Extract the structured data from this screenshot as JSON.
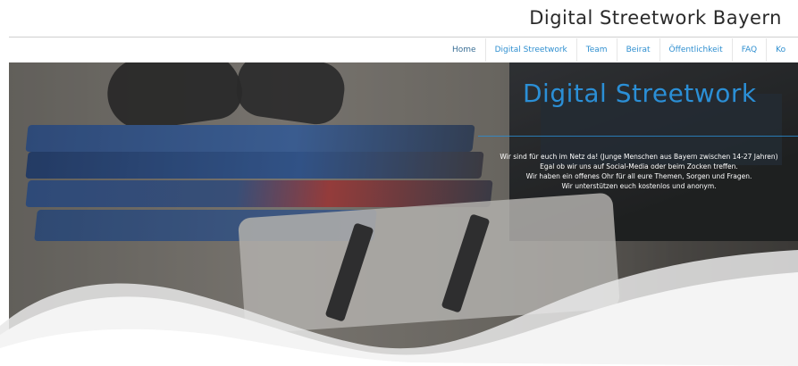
{
  "header": {
    "site_title": "Digital Streetwork Bayern"
  },
  "nav": {
    "items": [
      {
        "label": "Home",
        "active": true
      },
      {
        "label": "Digital Streetwork",
        "active": false
      },
      {
        "label": "Team",
        "active": false
      },
      {
        "label": "Beirat",
        "active": false
      },
      {
        "label": "Öffentlichkeit",
        "active": false
      },
      {
        "label": "FAQ",
        "active": false
      },
      {
        "label": "Ko",
        "active": false
      }
    ]
  },
  "hero": {
    "title": "Digital Streetwork",
    "lines": [
      "Wir sind für euch im Netz da! (Junge Menschen aus Bayern zwischen 14-27 Jahren)",
      "Egal ob wir uns auf Social-Media oder beim Zocken treffen.",
      "Wir haben ein offenes Ohr für all eure Themen, Sorgen und Fragen.",
      "Wir unterstützen euch kostenlos und anonym."
    ]
  },
  "colors": {
    "accent": "#2b8fd6",
    "nav_link": "#2f8fd0",
    "title_text": "#2a2a2a"
  }
}
